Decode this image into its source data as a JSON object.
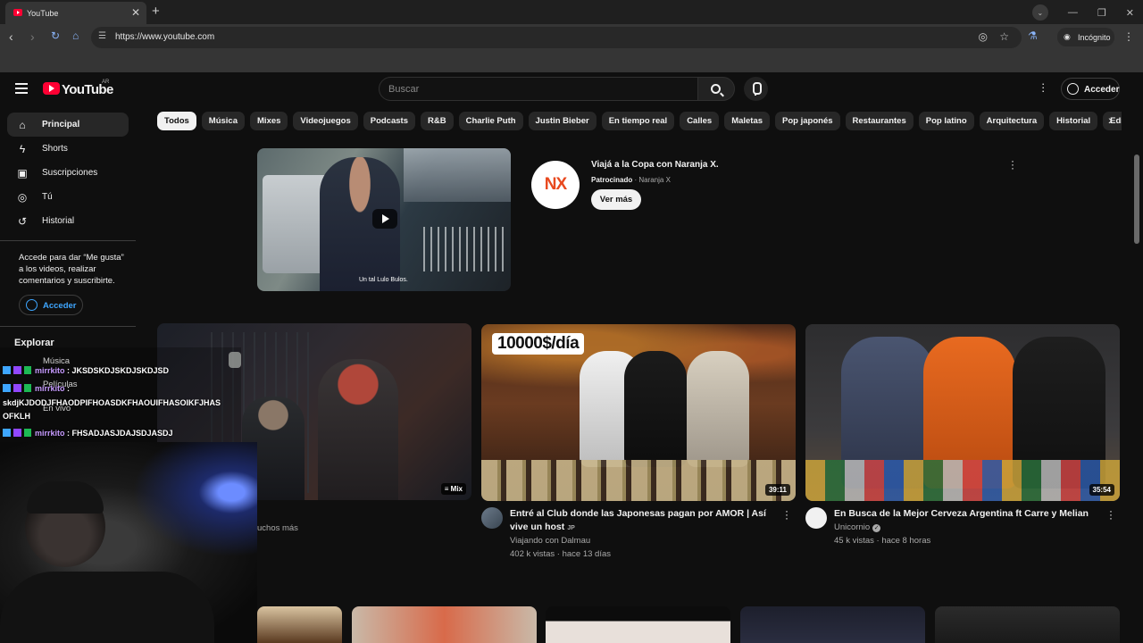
{
  "browser": {
    "tab_title": "YouTube",
    "close_glyph": "✕",
    "new_tab_glyph": "+",
    "url": "https://www.youtube.com",
    "incognito_label": "Incógnito"
  },
  "header": {
    "logo_text": "YouTube",
    "region": "AR",
    "search_placeholder": "Buscar",
    "signin_label": "Acceder"
  },
  "sidebar": {
    "items": [
      {
        "label": "Principal",
        "icon": "home-icon"
      },
      {
        "label": "Shorts",
        "icon": "shorts-icon"
      },
      {
        "label": "Suscripciones",
        "icon": "subscriptions-icon"
      },
      {
        "label": "Tú",
        "icon": "you-icon"
      },
      {
        "label": "Historial",
        "icon": "history-icon"
      }
    ],
    "signin_note": "Accede para dar “Me gusta” a los videos, realizar comentarios y suscribirte.",
    "signin_label": "Acceder",
    "explore_title": "Explorar"
  },
  "chips": [
    "Todos",
    "Música",
    "Mixes",
    "Videojuegos",
    "Podcasts",
    "R&B",
    "Charlie Puth",
    "Justin Bieber",
    "En tiempo real",
    "Calles",
    "Maletas",
    "Pop japonés",
    "Restaurantes",
    "Pop latino",
    "Arquitectura",
    "Historial",
    "Edific"
  ],
  "ad": {
    "thumb_caption": "Un tal Lulo Bulos.",
    "logo_text": "NX",
    "title": "Viajá a la Copa con Naranja X.",
    "sponsored": "Patrocinado",
    "sponsor": "Naranja X",
    "cta": "Ver más"
  },
  "videos": [
    {
      "badge": "Mix",
      "partial_text": "uchos más"
    },
    {
      "thumb_text": "10000$/día",
      "badge": "39:11",
      "title": "Entré al Club donde las Japonesas pagan por AMOR | Así vive un host",
      "title_suffix": "JP",
      "channel": "Viajando con Dalmau",
      "stats": "402 k vistas · hace 13 días"
    },
    {
      "badge": "35:54",
      "title": "En Busca de la Mejor Cerveza Argentina ft Carre y Melian",
      "channel": "Unicornio",
      "stats": "45 k vistas · hace 8 horas"
    }
  ],
  "overlay": {
    "ghost_items": [
      "Música",
      "Películas",
      "En vivo"
    ],
    "chat": [
      {
        "user": "mirrkito",
        "text": ": JKSDSKDJSKDJSKDJSD"
      },
      {
        "user": "mirrkito",
        "text": ":"
      },
      {
        "user": "",
        "text": "skdjKJDODJFHAODPIFHOASDKFHAOUIFHASOIKFJHAS"
      },
      {
        "user": "",
        "text": "OFKLH"
      },
      {
        "user": "mirrkito",
        "text": ": FHSADJASJDAJSDJASDJ"
      }
    ]
  }
}
